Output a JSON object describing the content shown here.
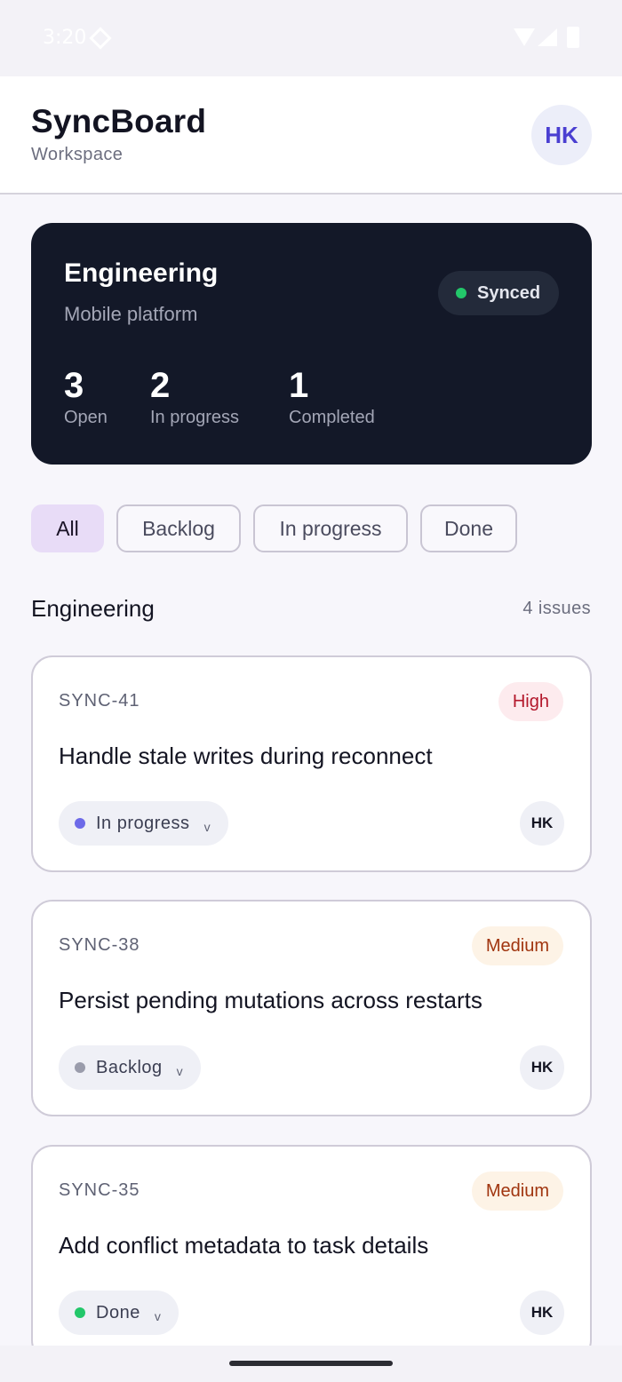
{
  "status_bar": {
    "time": "3:20"
  },
  "header": {
    "title": "SyncBoard",
    "subtitle": "Workspace",
    "avatar": "HK"
  },
  "summary": {
    "title": "Engineering",
    "subtitle": "Mobile platform",
    "sync_status": "Synced",
    "stats": [
      {
        "value": "3",
        "label": "Open"
      },
      {
        "value": "2",
        "label": "In progress"
      },
      {
        "value": "1",
        "label": "Completed"
      }
    ]
  },
  "filters": [
    "All",
    "Backlog",
    "In progress",
    "Done"
  ],
  "active_filter": "All",
  "section": {
    "title": "Engineering",
    "count": "4 issues"
  },
  "issues": [
    {
      "id": "SYNC-41",
      "priority": "High",
      "title": "Handle stale writes during reconnect",
      "status": "In progress",
      "assignee": "HK"
    },
    {
      "id": "SYNC-38",
      "priority": "Medium",
      "title": "Persist pending mutations across restarts",
      "status": "Backlog",
      "assignee": "HK"
    },
    {
      "id": "SYNC-35",
      "priority": "Medium",
      "title": "Add conflict metadata to task details",
      "status": "Done",
      "assignee": "HK"
    }
  ],
  "colors": {
    "accent": "#4a3fd1",
    "synced": "#23c76a",
    "priority_high_bg": "#fdebee",
    "priority_high_fg": "#b3172b",
    "priority_medium_bg": "#fdf3e6",
    "priority_medium_fg": "#a0350f",
    "status_in_progress": "#6d6ae8",
    "status_backlog": "#9a9cab",
    "status_done": "#23c76a"
  }
}
